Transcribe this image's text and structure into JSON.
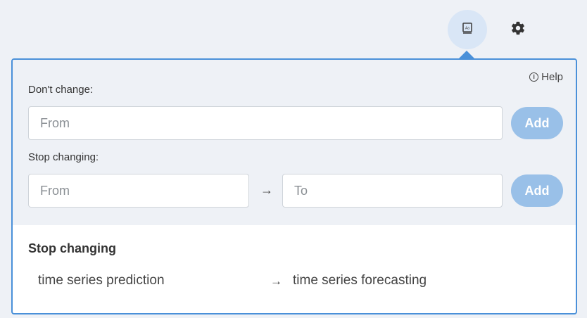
{
  "toolbar": {
    "dictionary_icon": "dictionary-icon",
    "gear_icon": "gear-icon"
  },
  "help": {
    "label": "Help"
  },
  "dont_change": {
    "label": "Don't change:",
    "from_placeholder": "From",
    "add_label": "Add"
  },
  "stop_changing": {
    "label": "Stop changing:",
    "from_placeholder": "From",
    "arrow": "→",
    "to_placeholder": "To",
    "add_label": "Add"
  },
  "list": {
    "title": "Stop changing",
    "entries": [
      {
        "from": "time series prediction",
        "arrow": "→",
        "to": "time series forecasting"
      }
    ]
  },
  "colors": {
    "accent": "#4a90d9",
    "add_button": "#99c0e8",
    "background": "#eef1f6"
  }
}
